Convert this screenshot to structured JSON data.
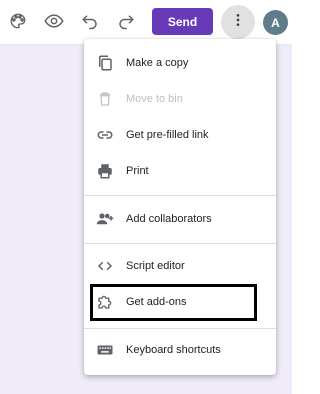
{
  "toolbar": {
    "icons": [
      "palette-icon",
      "preview-icon",
      "undo-icon",
      "redo-icon",
      "more-vert-icon"
    ],
    "send_label": "Send",
    "avatar_initial": "A"
  },
  "menu": {
    "items": [
      {
        "label": "Make a copy",
        "icon": "copy-icon",
        "disabled": false
      },
      {
        "label": "Move to bin",
        "icon": "trash-icon",
        "disabled": true
      },
      {
        "label": "Get pre-filled link",
        "icon": "link-icon",
        "disabled": false
      },
      {
        "label": "Print",
        "icon": "printer-icon",
        "disabled": false
      },
      {
        "label": "Add collaborators",
        "icon": "add-people-icon",
        "disabled": false
      },
      {
        "label": "Script editor",
        "icon": "code-icon",
        "disabled": false
      },
      {
        "label": "Get add-ons",
        "icon": "puzzle-icon",
        "disabled": false
      },
      {
        "label": "Keyboard shortcuts",
        "icon": "keyboard-icon",
        "disabled": false
      }
    ]
  },
  "colors": {
    "accent": "#673ab7",
    "background": "#f0ebf8",
    "avatar": "#5f7c8a",
    "highlight": "#000000"
  }
}
